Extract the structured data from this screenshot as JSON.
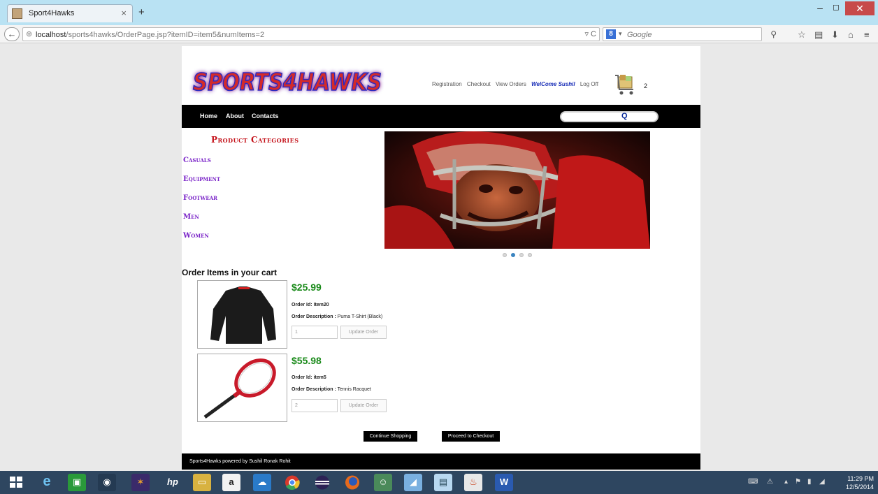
{
  "browser": {
    "tab_title": "Sport4Hawks",
    "tab_close": "×",
    "new_tab": "+",
    "url_host": "localhost",
    "url_path": "/sports4hawks/OrderPage.jsp?itemID=item5&numItems=2",
    "url_controls": "▿ C",
    "search_engine_badge": "8",
    "search_placeholder": "Google",
    "window_controls": {
      "minimize": "–",
      "maximize": "◻",
      "close": "✕"
    },
    "toolbar_icons": [
      "search-icon",
      "star-icon",
      "reading-list-icon",
      "download-icon",
      "home-icon",
      "menu-icon"
    ]
  },
  "site": {
    "logo_text": "SPORTS4HAWKS",
    "top_links": {
      "registration": "Registration",
      "checkout": "Checkout",
      "view_orders": "View Orders",
      "welcome": "WelCome Sushil",
      "logoff": "Log Off"
    },
    "cart_count": "2",
    "menu": {
      "home": "Home",
      "about": "About",
      "contacts": "Contacts"
    },
    "search_button": "Q",
    "categories_title": "Product Categories",
    "categories": [
      "Casuals",
      "Equipment",
      "Footwear",
      "Men",
      "Women"
    ],
    "carousel": {
      "slides": 4,
      "active": 1
    },
    "order_title": "Order Items in your cart",
    "order_id_label": "Order Id:",
    "order_desc_label": "Order Description :",
    "update_label": "Update Order",
    "items": [
      {
        "price": "$25.99",
        "order_id": "item20",
        "description": "Puma T-Shirt (Black)",
        "qty": "1",
        "image": "black-shirt"
      },
      {
        "price": "$55.98",
        "order_id": "item5",
        "description": "Tennis Racquet",
        "qty": "2",
        "image": "tennis-racquet"
      }
    ],
    "continue_button": "Continue Shopping",
    "checkout_button": "Proceed to Checkout",
    "footer_text": "Sports4Hawks powered by Sushil Ronak Rohit"
  },
  "taskbar": {
    "apps": [
      "windows-start-icon",
      "internet-explorer-icon",
      "store-icon",
      "camera-icon",
      "photos-icon",
      "hp-icon",
      "file-explorer-icon",
      "amazon-icon",
      "weather-icon",
      "chrome-icon",
      "eclipse-icon",
      "firefox-icon",
      "android-icon",
      "notes-icon",
      "presentation-icon",
      "java-icon",
      "word-icon"
    ],
    "time": "11:29 PM",
    "date": "12/5/2014"
  },
  "colors": {
    "price_green": "#1a8a1a",
    "category_purple": "#7a24c8",
    "category_title_red": "#c4121a",
    "welcome_blue": "#1a2fb8",
    "taskbar": "#2e4660",
    "titlebar": "#b9e2f3"
  }
}
